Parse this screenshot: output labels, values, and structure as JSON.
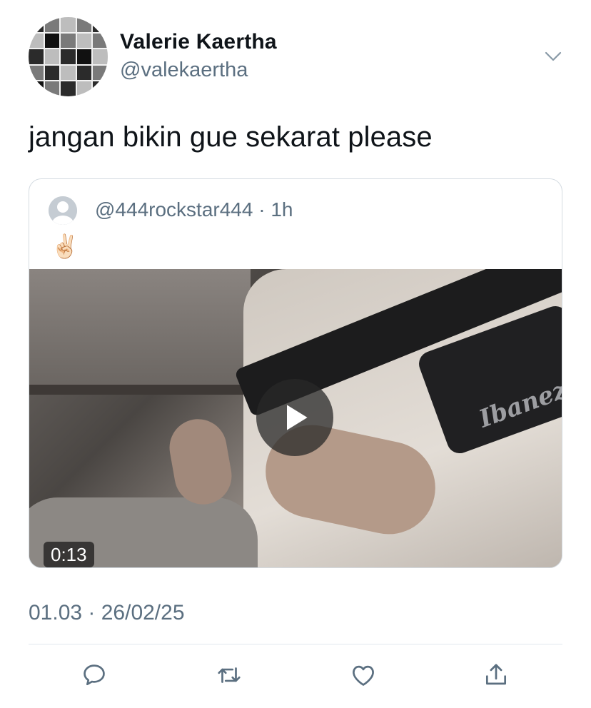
{
  "tweet": {
    "display_name": "Valerie Kaertha",
    "handle": "@valekaertha",
    "text": "jangan bikin gue sekarat please",
    "timestamp": "01.03 · 26/02/25"
  },
  "quoted": {
    "handle_time": "@444rockstar444 · 1h",
    "emoji": "✌🏻",
    "video_duration": "0:13",
    "video_brand_text": "Ibanez"
  },
  "icons": {
    "more": "chevron-down-icon",
    "reply": "reply-icon",
    "retweet": "retweet-icon",
    "like": "heart-icon",
    "share": "share-icon",
    "play": "play-icon"
  },
  "colors": {
    "text": "#0f1419",
    "secondary": "#5b6f80",
    "border": "#d4dbe1"
  }
}
